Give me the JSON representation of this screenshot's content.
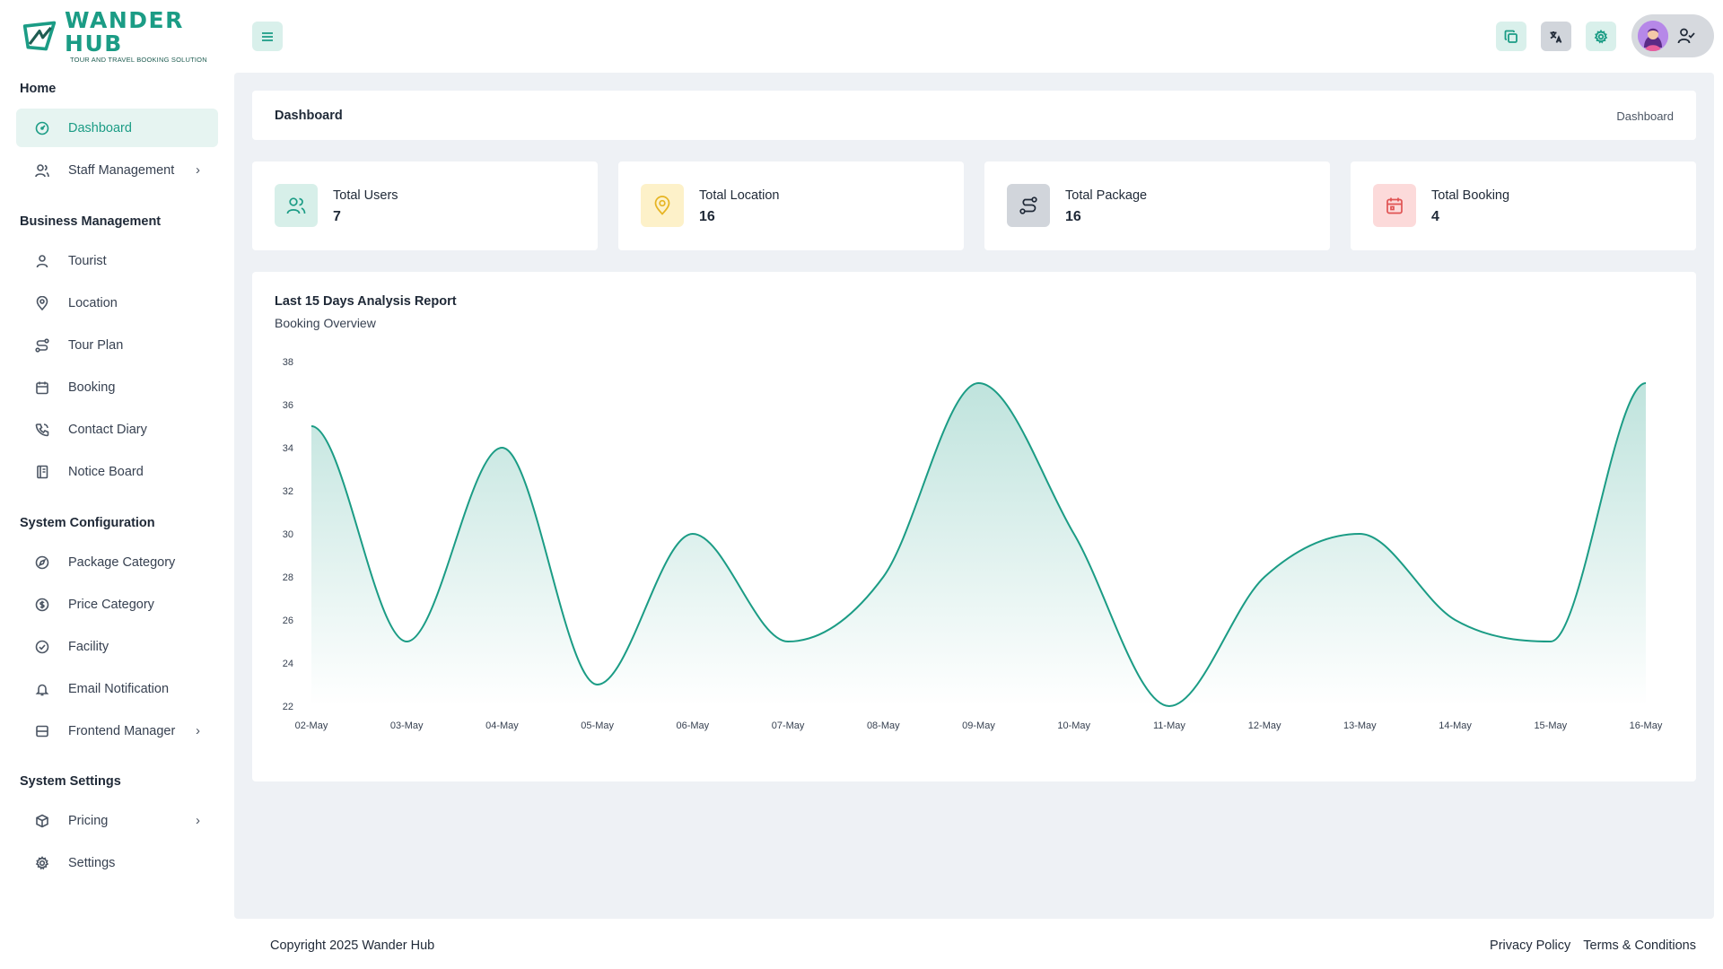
{
  "brand": {
    "name": "WANDER HUB",
    "tagline": "TOUR AND TRAVEL BOOKING SOLUTION"
  },
  "sidebar": {
    "sections": [
      {
        "label": "Home"
      },
      {
        "label": "Business Management"
      },
      {
        "label": "System Configuration"
      },
      {
        "label": "System Settings"
      }
    ],
    "items": [
      {
        "label": "Dashboard",
        "icon": "dashboard-icon",
        "active": true
      },
      {
        "label": "Staff Management",
        "icon": "users-icon",
        "has_children": true
      },
      {
        "label": "Tourist",
        "icon": "user-icon"
      },
      {
        "label": "Location",
        "icon": "location-pin-icon"
      },
      {
        "label": "Tour Plan",
        "icon": "route-icon"
      },
      {
        "label": "Booking",
        "icon": "calendar-icon"
      },
      {
        "label": "Contact Diary",
        "icon": "phone-icon"
      },
      {
        "label": "Notice Board",
        "icon": "notebook-icon"
      },
      {
        "label": "Package Category",
        "icon": "compass-icon"
      },
      {
        "label": "Price Category",
        "icon": "dollar-icon"
      },
      {
        "label": "Facility",
        "icon": "check-circle-icon"
      },
      {
        "label": "Email Notification",
        "icon": "bell-icon"
      },
      {
        "label": "Frontend Manager",
        "icon": "layout-icon",
        "has_children": true
      },
      {
        "label": "Pricing",
        "icon": "package-icon",
        "has_children": true
      },
      {
        "label": "Settings",
        "icon": "gear-icon"
      }
    ],
    "chevron": "›"
  },
  "header": {
    "icons": [
      "menu-icon",
      "copy-icon",
      "translate-icon",
      "gear-icon",
      "user-check-icon"
    ]
  },
  "breadcrumb": {
    "title": "Dashboard",
    "path": "Dashboard"
  },
  "stats": [
    {
      "label": "Total Users",
      "value": "7",
      "icon": "users-icon",
      "bg": "#d7efe9",
      "color": "#1b9c85"
    },
    {
      "label": "Total Location",
      "value": "16",
      "icon": "location-pin-icon",
      "bg": "#fdf1c9",
      "color": "#e6b422"
    },
    {
      "label": "Total Package",
      "value": "16",
      "icon": "route-icon",
      "bg": "#d1d5db",
      "color": "#1f2937"
    },
    {
      "label": "Total Booking",
      "value": "4",
      "icon": "calendar-icon",
      "bg": "#fcdada",
      "color": "#e05353"
    }
  ],
  "chart": {
    "title": "Last 15 Days Analysis Report",
    "subtitle": "Booking Overview"
  },
  "chart_data": {
    "type": "area",
    "categories": [
      "02-May",
      "03-May",
      "04-May",
      "05-May",
      "06-May",
      "07-May",
      "08-May",
      "09-May",
      "10-May",
      "11-May",
      "12-May",
      "13-May",
      "14-May",
      "15-May",
      "16-May"
    ],
    "series": [
      {
        "values": [
          35,
          25,
          34,
          23,
          30,
          25,
          28,
          37,
          30,
          22,
          28,
          30,
          26,
          25,
          37
        ]
      }
    ],
    "ylim": [
      22,
      38
    ],
    "yticks": [
      22,
      24,
      26,
      28,
      30,
      32,
      34,
      36,
      38
    ],
    "color": "#1b9c85",
    "grid": false
  },
  "footer": {
    "copyright": "Copyright 2025 Wander Hub",
    "links": [
      "Privacy Policy",
      "Terms & Conditions"
    ]
  }
}
